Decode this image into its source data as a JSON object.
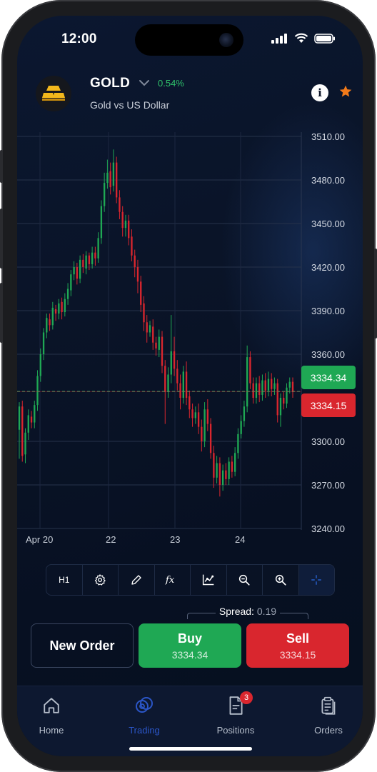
{
  "status_bar": {
    "time": "12:00"
  },
  "asset": {
    "symbol": "GOLD",
    "change": "0.54%",
    "description": "Gold vs US Dollar",
    "logo_icon": "gold-bars-icon"
  },
  "header_actions": {
    "info_label": "i",
    "favorite_icon": "star-icon"
  },
  "chart_data": {
    "type": "candlestick",
    "title": "",
    "xlabel": "",
    "ylabel": "",
    "timeframe": "H1",
    "y_ticks": [
      "3510.00",
      "3480.00",
      "3450.00",
      "3420.00",
      "3390.00",
      "3360.00",
      "3300.00",
      "3270.00",
      "3240.00"
    ],
    "ylim": [
      3240,
      3510
    ],
    "x_ticks": [
      "Apr 20",
      "22",
      "23",
      "24"
    ],
    "grid": true,
    "bid": 3334.15,
    "ask": 3334.34,
    "candles": [
      [
        3308,
        3324,
        3288,
        3327
      ],
      [
        3324,
        3290,
        3286,
        3328
      ],
      [
        3291,
        3306,
        3285,
        3309
      ],
      [
        3306,
        3318,
        3301,
        3322
      ],
      [
        3317,
        3313,
        3309,
        3321
      ],
      [
        3313,
        3325,
        3309,
        3328
      ],
      [
        3325,
        3345,
        3321,
        3349
      ],
      [
        3345,
        3360,
        3341,
        3364
      ],
      [
        3360,
        3375,
        3356,
        3378
      ],
      [
        3375,
        3385,
        3371,
        3388
      ],
      [
        3384,
        3380,
        3376,
        3388
      ],
      [
        3380,
        3392,
        3377,
        3396
      ],
      [
        3391,
        3388,
        3383,
        3394
      ],
      [
        3388,
        3395,
        3384,
        3398
      ],
      [
        3396,
        3389,
        3384,
        3399
      ],
      [
        3389,
        3398,
        3386,
        3402
      ],
      [
        3398,
        3405,
        3394,
        3409
      ],
      [
        3404,
        3415,
        3400,
        3418
      ],
      [
        3415,
        3420,
        3411,
        3424
      ],
      [
        3420,
        3412,
        3408,
        3423
      ],
      [
        3412,
        3425,
        3409,
        3428
      ],
      [
        3425,
        3420,
        3416,
        3429
      ],
      [
        3419,
        3428,
        3415,
        3431
      ],
      [
        3428,
        3422,
        3418,
        3430
      ],
      [
        3422,
        3430,
        3419,
        3434
      ],
      [
        3430,
        3426,
        3421,
        3434
      ],
      [
        3426,
        3440,
        3423,
        3444
      ],
      [
        3440,
        3462,
        3436,
        3466
      ],
      [
        3462,
        3478,
        3458,
        3485
      ],
      [
        3478,
        3485,
        3474,
        3494
      ],
      [
        3486,
        3475,
        3470,
        3492
      ],
      [
        3476,
        3492,
        3472,
        3501
      ],
      [
        3492,
        3468,
        3464,
        3496
      ],
      [
        3468,
        3458,
        3453,
        3473
      ],
      [
        3458,
        3447,
        3441,
        3462
      ],
      [
        3447,
        3452,
        3441,
        3456
      ],
      [
        3452,
        3440,
        3435,
        3456
      ],
      [
        3441,
        3428,
        3424,
        3446
      ],
      [
        3428,
        3420,
        3413,
        3432
      ],
      [
        3420,
        3410,
        3402,
        3425
      ],
      [
        3410,
        3394,
        3389,
        3414
      ],
      [
        3395,
        3382,
        3376,
        3400
      ],
      [
        3382,
        3375,
        3368,
        3387
      ],
      [
        3375,
        3380,
        3372,
        3383
      ],
      [
        3379,
        3368,
        3363,
        3384
      ],
      [
        3368,
        3364,
        3359,
        3372
      ],
      [
        3363,
        3372,
        3358,
        3377
      ],
      [
        3372,
        3352,
        3347,
        3376
      ],
      [
        3352,
        3334,
        3312,
        3356
      ],
      [
        3334,
        3346,
        3330,
        3351
      ],
      [
        3346,
        3362,
        3340,
        3387
      ],
      [
        3362,
        3350,
        3345,
        3372
      ],
      [
        3350,
        3340,
        3335,
        3356
      ],
      [
        3340,
        3330,
        3322,
        3346
      ],
      [
        3330,
        3348,
        3326,
        3352
      ],
      [
        3348,
        3330,
        3325,
        3355
      ],
      [
        3331,
        3322,
        3316,
        3335
      ],
      [
        3322,
        3316,
        3310,
        3326
      ],
      [
        3316,
        3320,
        3312,
        3324
      ],
      [
        3320,
        3310,
        3305,
        3326
      ],
      [
        3310,
        3300,
        3293,
        3315
      ],
      [
        3300,
        3322,
        3296,
        3327
      ],
      [
        3322,
        3312,
        3307,
        3329
      ],
      [
        3312,
        3292,
        3288,
        3316
      ],
      [
        3292,
        3275,
        3268,
        3297
      ],
      [
        3275,
        3285,
        3271,
        3290
      ],
      [
        3285,
        3270,
        3262,
        3289
      ],
      [
        3270,
        3280,
        3266,
        3284
      ],
      [
        3280,
        3274,
        3270,
        3285
      ],
      [
        3274,
        3286,
        3270,
        3289
      ],
      [
        3286,
        3279,
        3275,
        3290
      ],
      [
        3279,
        3292,
        3276,
        3296
      ],
      [
        3292,
        3305,
        3288,
        3309
      ],
      [
        3305,
        3314,
        3302,
        3318
      ],
      [
        3314,
        3324,
        3310,
        3328
      ],
      [
        3324,
        3358,
        3320,
        3366
      ],
      [
        3358,
        3340,
        3336,
        3362
      ],
      [
        3340,
        3330,
        3326,
        3344
      ],
      [
        3330,
        3340,
        3326,
        3344
      ],
      [
        3340,
        3332,
        3327,
        3345
      ],
      [
        3332,
        3342,
        3328,
        3346
      ],
      [
        3342,
        3335,
        3330,
        3347
      ],
      [
        3335,
        3343,
        3331,
        3348
      ],
      [
        3343,
        3336,
        3331,
        3347
      ],
      [
        3336,
        3340,
        3332,
        3344
      ],
      [
        3340,
        3318,
        3313,
        3343
      ],
      [
        3318,
        3330,
        3310,
        3333
      ],
      [
        3330,
        3326,
        3322,
        3334
      ],
      [
        3326,
        3337,
        3323,
        3340
      ],
      [
        3337,
        3341,
        3333,
        3344
      ],
      [
        3341,
        3334,
        3330,
        3344
      ]
    ]
  },
  "price_tags": {
    "ask": "3334.34",
    "bid": "3334.15"
  },
  "toolbar": {
    "timeframe_label": "H1",
    "icons": [
      "settings-icon",
      "pencil-icon",
      "function-icon",
      "indicator-chart-icon",
      "zoom-out-icon",
      "zoom-in-icon",
      "crosshair-icon"
    ]
  },
  "spread": {
    "label": "Spread:",
    "value": "0.19"
  },
  "actions": {
    "new_order_label": "New Order",
    "buy_label": "Buy",
    "buy_price": "3334.34",
    "sell_label": "Sell",
    "sell_price": "3334.15"
  },
  "tabs": [
    {
      "label": "Home",
      "icon": "home-icon",
      "active": false
    },
    {
      "label": "Trading",
      "icon": "trading-coins-icon",
      "active": true
    },
    {
      "label": "Positions",
      "icon": "document-icon",
      "active": false,
      "badge": "3"
    },
    {
      "label": "Orders",
      "icon": "clipboard-icon",
      "active": false
    }
  ],
  "colors": {
    "up": "#1fa854",
    "down": "#d9262e",
    "accent": "#2b56c8",
    "change_positive": "#2fc26b"
  }
}
